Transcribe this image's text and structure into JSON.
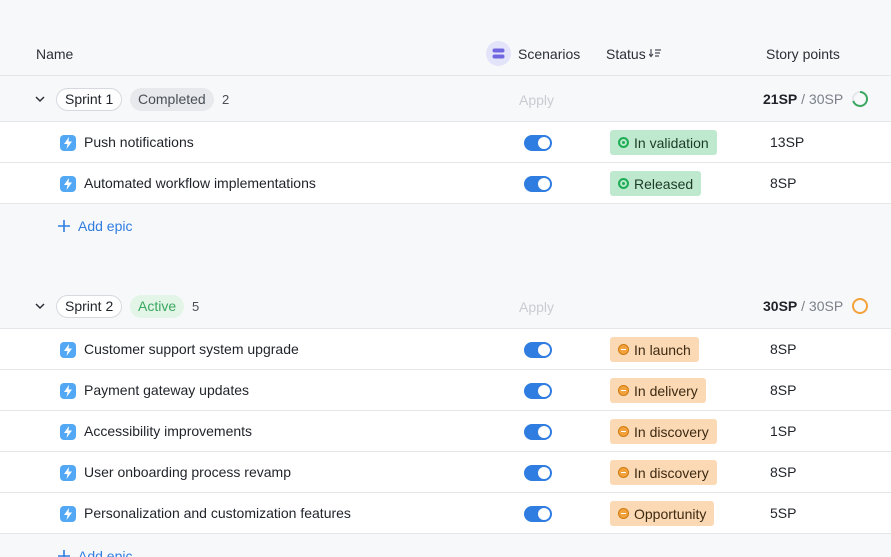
{
  "header": {
    "name": "Name",
    "scenarios": "Scenarios",
    "status": "Status",
    "status_sort_icon": "sort-desc-icon",
    "story_points": "Story points"
  },
  "colors": {
    "accent": "#2f7de1",
    "epic_icon": "#52a8f5",
    "green_status_bg": "#bfe9cf",
    "orange_status_bg": "#fbd9b4",
    "completed_ring": "#3aa860",
    "active_ring": "#f2a23c"
  },
  "sprints": [
    {
      "name": "Sprint 1",
      "state": "Completed",
      "count": "2",
      "apply": "Apply",
      "sp_done": "21SP",
      "sp_sep": " / ",
      "sp_total": "30SP",
      "progress": 0.7,
      "add_label": "Add epic",
      "epics": [
        {
          "title": "Push notifications",
          "status": "In validation",
          "tone": "green",
          "sp": "13SP",
          "scenario_on": true
        },
        {
          "title": "Automated workflow implementations",
          "status": "Released",
          "tone": "green",
          "sp": "8SP",
          "scenario_on": true
        }
      ]
    },
    {
      "name": "Sprint 2",
      "state": "Active",
      "count": "5",
      "apply": "Apply",
      "sp_done": "30SP",
      "sp_sep": " / ",
      "sp_total": "30SP",
      "progress": 1.0,
      "add_label": "Add epic",
      "epics": [
        {
          "title": "Customer support system upgrade",
          "status": "In launch",
          "tone": "orange",
          "sp": "8SP",
          "scenario_on": true
        },
        {
          "title": "Payment gateway updates",
          "status": "In delivery",
          "tone": "orange",
          "sp": "8SP",
          "scenario_on": true
        },
        {
          "title": "Accessibility improvements",
          "status": "In discovery",
          "tone": "orange",
          "sp": "1SP",
          "scenario_on": true
        },
        {
          "title": "User onboarding process revamp",
          "status": "In discovery",
          "tone": "orange",
          "sp": "8SP",
          "scenario_on": true
        },
        {
          "title": "Personalization and customization features",
          "status": "Opportunity",
          "tone": "orange",
          "sp": "5SP",
          "scenario_on": true
        }
      ]
    }
  ]
}
